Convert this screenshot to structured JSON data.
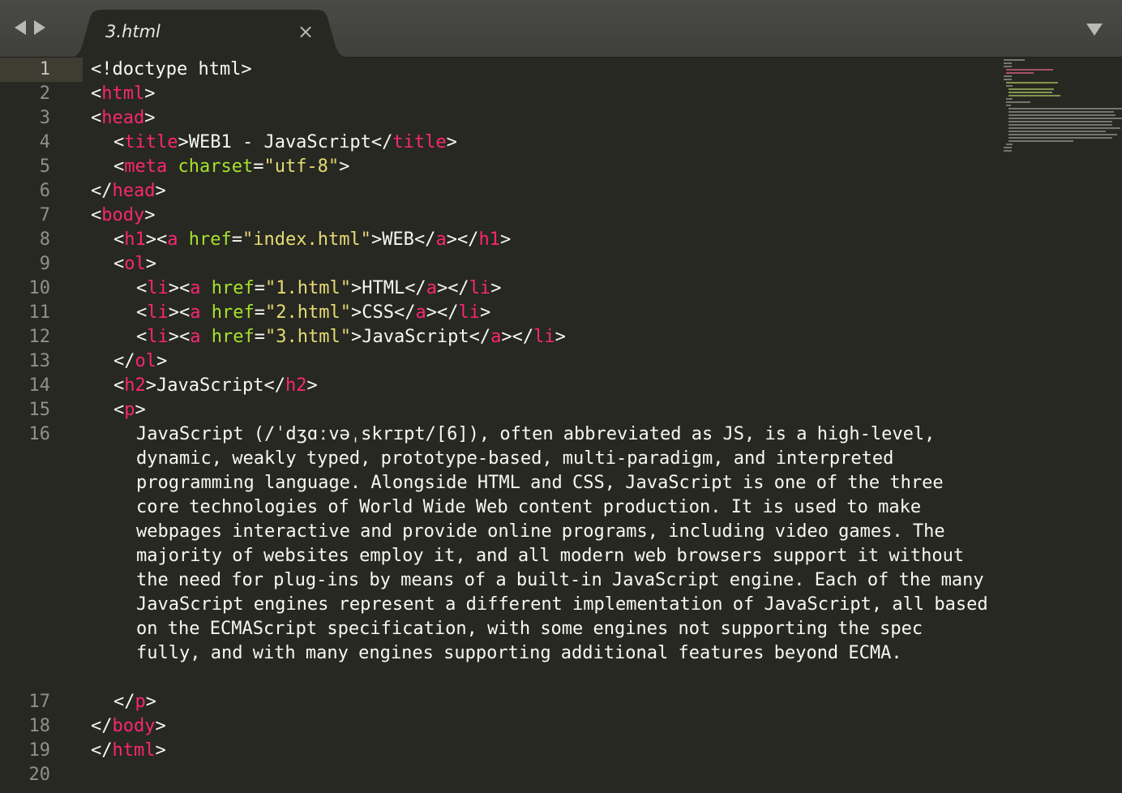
{
  "window": {
    "tab_title": "3.html",
    "tab_close_glyph": "×"
  },
  "icons": {
    "back": "arrow-left-icon",
    "forward": "arrow-right-icon",
    "close": "close-icon",
    "dropdown": "chevron-down-icon"
  },
  "colors": {
    "background": "#272822",
    "tag": "#f92672",
    "attribute": "#a6e22e",
    "string": "#e6db74",
    "text": "#f8f8f2",
    "gutter_text": "#8f908a"
  },
  "editor": {
    "line_numbers": [
      "1",
      "2",
      "3",
      "4",
      "5",
      "6",
      "7",
      "8",
      "9",
      "10",
      "11",
      "12",
      "13",
      "14",
      "15",
      "16",
      "17",
      "18",
      "19",
      "20"
    ],
    "active_line": "1",
    "code": {
      "l1": "<!doctype html>",
      "lt": "<",
      "gt": ">",
      "lts": "</",
      "eq": "=",
      "html": "html",
      "head": "head",
      "title": "title",
      "title_text": "WEB1 - JavaScript",
      "meta": "meta",
      "charset_attr": "charset",
      "charset_val": "\"utf-8\"",
      "body": "body",
      "h1": "h1",
      "a": "a",
      "href": "href",
      "href_index": "\"index.html\"",
      "web_text": "WEB",
      "ol": "ol",
      "li": "li",
      "href_1": "\"1.html\"",
      "text_html": "HTML",
      "href_2": "\"2.html\"",
      "text_css": "CSS",
      "href_3": "\"3.html\"",
      "text_js": "JavaScript",
      "h2": "h2",
      "h2_text": "JavaScript",
      "p": "p",
      "paragraph": "JavaScript (/ˈdʒɑːvəˌskrɪpt/[6]), often abbreviated as JS, is a high-level, dynamic, weakly typed, prototype-based, multi-paradigm, and interpreted programming language. Alongside HTML and CSS, JavaScript is one of the three core technologies of World Wide Web content production. It is used to make webpages interactive and provide online programs, including video games. The majority of websites employ it, and all modern web browsers support it without the need for plug-ins by means of a built-in JavaScript engine. Each of the many JavaScript engines represent a different implementation of JavaScript, all based on the ECMAScript specification, with some engines not supporting the spec fully, and with many engines supporting additional features beyond ECMA."
    }
  }
}
